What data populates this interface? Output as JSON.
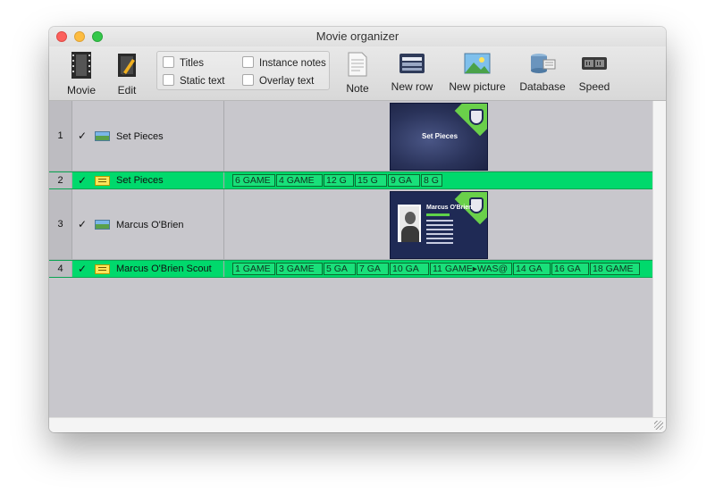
{
  "window": {
    "title": "Movie organizer"
  },
  "toolbar": {
    "movie": "Movie",
    "edit": "Edit",
    "checkboxes": {
      "titles": "Titles",
      "static_text": "Static text",
      "instance_notes": "Instance notes",
      "overlay_text": "Overlay text"
    },
    "note": "Note",
    "new_row": "New row",
    "new_picture": "New picture",
    "database": "Database",
    "speed": "Speed"
  },
  "rows": [
    {
      "num": "1",
      "check": "✓",
      "name": "Set Pieces",
      "kind": "picture",
      "thumb_title": "Set Pieces"
    },
    {
      "num": "2",
      "check": "✓",
      "name": "Set Pieces",
      "kind": "text",
      "clips": [
        "6  GAME",
        "4  GAME",
        "12  G",
        "15  G",
        "9  GA",
        "8  G"
      ]
    },
    {
      "num": "3",
      "check": "✓",
      "name": "Marcus O'Brien",
      "kind": "picture",
      "thumb_title": "Marcus O'Brien"
    },
    {
      "num": "4",
      "check": "✓",
      "name": "Marcus O'Brien Scout",
      "kind": "text",
      "clips": [
        "1  GAME",
        "3  GAME",
        "5  GA",
        "7  GA",
        "10  GA",
        "11  GAME▸WAS@",
        "14  GA",
        "16  GA",
        "18  GAME"
      ]
    }
  ]
}
